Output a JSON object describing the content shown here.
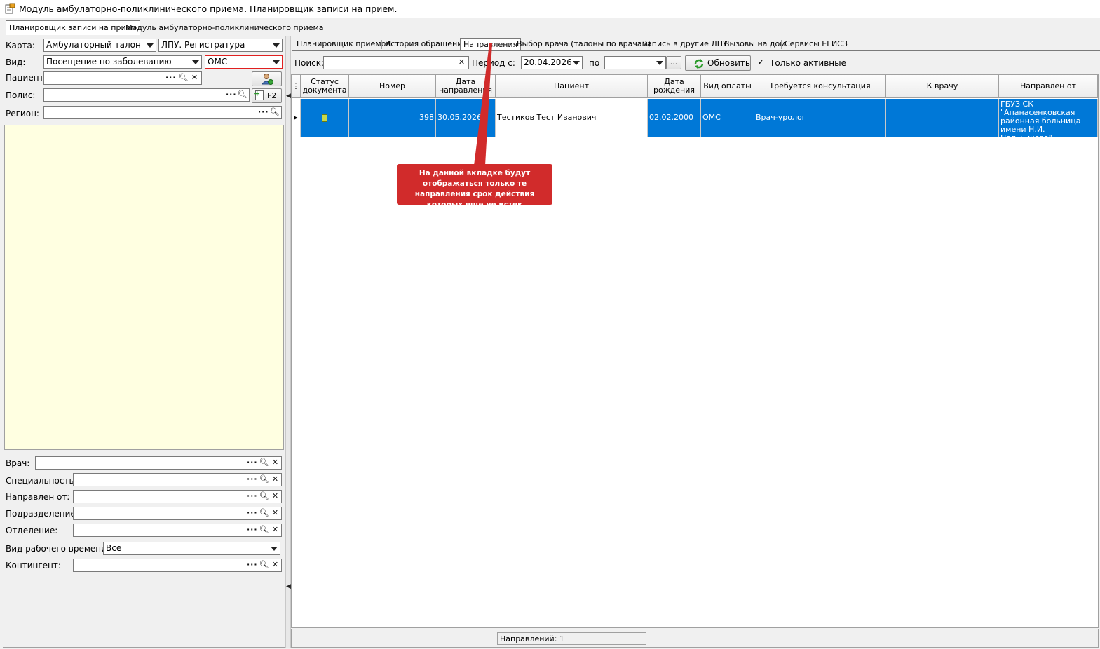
{
  "window": {
    "title": "Модуль амбулаторно-поликлинического приема. Планировщик записи на прием."
  },
  "top_tabs": [
    {
      "label": "Планировщик записи на прием",
      "active": true
    },
    {
      "label": "Модуль амбулаторно-поликлинического приема",
      "active": false
    }
  ],
  "left": {
    "karta_label": "Карта:",
    "karta_value": "Амбулаторный талон",
    "lpu_value": "ЛПУ. Регистратура",
    "vid_label": "Вид:",
    "vid_value": "Посещение по заболеванию",
    "oms_value": "ОМС",
    "patient_label": "Пациент:",
    "polis_label": "Полис:",
    "f2_label": "F2",
    "region_label": "Регион:",
    "doctor_label": "Врач:",
    "speciality_label": "Специальность:",
    "referred_from_label": "Направлен от:",
    "subdivision_label": "Подразделение:",
    "department_label": "Отделение:",
    "work_time_label": "Вид рабочего времени:",
    "work_time_value": "Все",
    "contingent_label": "Контингент:"
  },
  "sub_tabs": [
    {
      "label": "Планировщик приемов",
      "active": false
    },
    {
      "label": "История обращения",
      "active": false
    },
    {
      "label": "Направления",
      "active": true
    },
    {
      "label": "Выбор врача (талоны по врачам)",
      "active": false
    },
    {
      "label": "Запись в другие ЛПУ",
      "active": false
    },
    {
      "label": "Вызовы на дом",
      "active": false
    },
    {
      "label": "Сервисы ЕГИСЗ",
      "active": false
    }
  ],
  "toolbar": {
    "search_label": "Поиск:",
    "search_value": "",
    "period_label": "Период с:",
    "period_from": "20.04.2026",
    "period_to_label": "по",
    "period_to": "",
    "ellipsis": "...",
    "refresh_label": "Обновить",
    "only_active_label": "Только активные",
    "only_active_checked": true
  },
  "grid": {
    "columns": [
      {
        "label": "Статус документа"
      },
      {
        "label": "Номер"
      },
      {
        "label": "Дата направления"
      },
      {
        "label": "Пациент"
      },
      {
        "label": "Дата рождения"
      },
      {
        "label": "Вид оплаты"
      },
      {
        "label": "Требуется консультация"
      },
      {
        "label": "К врачу"
      },
      {
        "label": "Направлен от"
      }
    ],
    "rows": [
      {
        "number": "398",
        "date": "30.05.2026",
        "patient": "Тестиков Тест Иванович",
        "birth_date": "02.02.2000",
        "payment": "ОМС",
        "consultation": "Врач-уролог",
        "to_doctor": "",
        "referred_from": "ГБУЗ СК \"Апанасенковская районная больница имени Н.И. Пальчикова\""
      }
    ]
  },
  "status": {
    "count_text": "Направлений: 1"
  },
  "tooltip": {
    "text": "На данной вкладке будут отображаться только те направления срок действия которых еще не истек"
  },
  "colors": {
    "selection": "#0078d7",
    "tooltip_bg": "#d12b2b",
    "panel_yellow": "#ffffe1",
    "required_border": "#e02020"
  }
}
